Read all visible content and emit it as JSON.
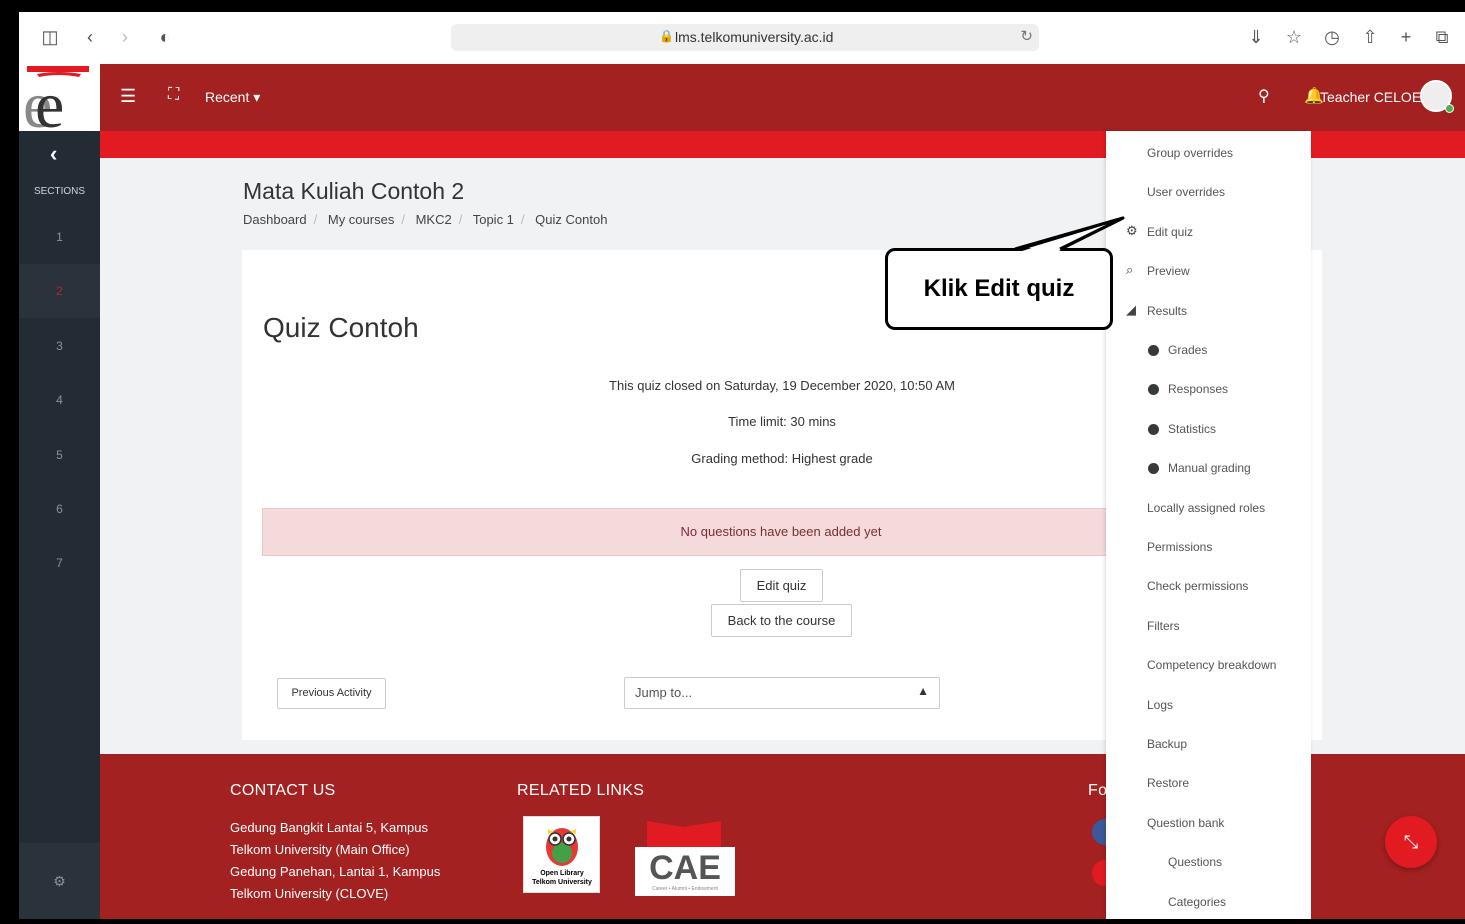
{
  "browser": {
    "url": "lms.telkomuniversity.ac.id"
  },
  "header": {
    "recent_label": "Recent ▾",
    "user_name": "Teacher CELOE"
  },
  "sidebar": {
    "sections_label": "SECTIONS",
    "items": [
      "1",
      "2",
      "3",
      "4",
      "5",
      "6",
      "7"
    ],
    "active_item": "2"
  },
  "course": {
    "title": "Mata Kuliah Contoh 2",
    "breadcrumb": [
      "Dashboard",
      "My courses",
      "MKC2",
      "Topic 1",
      "Quiz Contoh"
    ]
  },
  "quiz": {
    "title": "Quiz Contoh",
    "closed_text": "This quiz closed on Saturday, 19 December 2020, 10:50 AM",
    "time_limit": "Time limit: 30 mins",
    "grading_method": "Grading method: Highest grade",
    "alert": "No questions have been added yet",
    "edit_button": "Edit quiz",
    "back_button": "Back to the course",
    "previous_activity": "Previous Activity",
    "jump_placeholder": "Jump to..."
  },
  "footer": {
    "contact_title": "CONTACT US",
    "contact_lines": [
      "Gedung Bangkit Lantai 5, Kampus",
      "Telkom University (Main Office)",
      "Gedung Panehan, Lantai 1, Kampus",
      "Telkom University (CLOVE)"
    ],
    "related_title": "RELATED LINKS",
    "follow_title_partial": "Fo",
    "owl_caption_1": "Open Library",
    "owl_caption_2": "Telkom University",
    "cae_text": "CAE",
    "cae_sub": "Career • Alumni • Endowment"
  },
  "dropdown": {
    "items": [
      {
        "label": "Group overrides",
        "icon": "",
        "level": 0
      },
      {
        "label": "User overrides",
        "icon": "",
        "level": 0
      },
      {
        "label": "Edit quiz",
        "icon": "gear-icon",
        "level": 0
      },
      {
        "label": "Preview",
        "icon": "zoom-icon",
        "level": 0
      },
      {
        "label": "Results",
        "icon": "area-chart-icon",
        "level": 0
      },
      {
        "label": "Grades",
        "icon": "dot",
        "level": 1
      },
      {
        "label": "Responses",
        "icon": "dot",
        "level": 1
      },
      {
        "label": "Statistics",
        "icon": "dot",
        "level": 1
      },
      {
        "label": "Manual grading",
        "icon": "dot",
        "level": 1
      },
      {
        "label": "Locally assigned roles",
        "icon": "",
        "level": 0
      },
      {
        "label": "Permissions",
        "icon": "",
        "level": 0
      },
      {
        "label": "Check permissions",
        "icon": "",
        "level": 0
      },
      {
        "label": "Filters",
        "icon": "",
        "level": 0
      },
      {
        "label": "Competency breakdown",
        "icon": "",
        "level": 0
      },
      {
        "label": "Logs",
        "icon": "",
        "level": 0
      },
      {
        "label": "Backup",
        "icon": "",
        "level": 0
      },
      {
        "label": "Restore",
        "icon": "",
        "level": 0
      },
      {
        "label": "Question bank",
        "icon": "",
        "level": 0
      },
      {
        "label": "Questions",
        "icon": "",
        "level": 2
      },
      {
        "label": "Categories",
        "icon": "",
        "level": 2
      }
    ]
  },
  "callout": {
    "text": "Klik Edit quiz"
  },
  "colors": {
    "header_red": "#a42121",
    "strip_red": "#e21b23",
    "sidebar_dark": "#232c35"
  }
}
